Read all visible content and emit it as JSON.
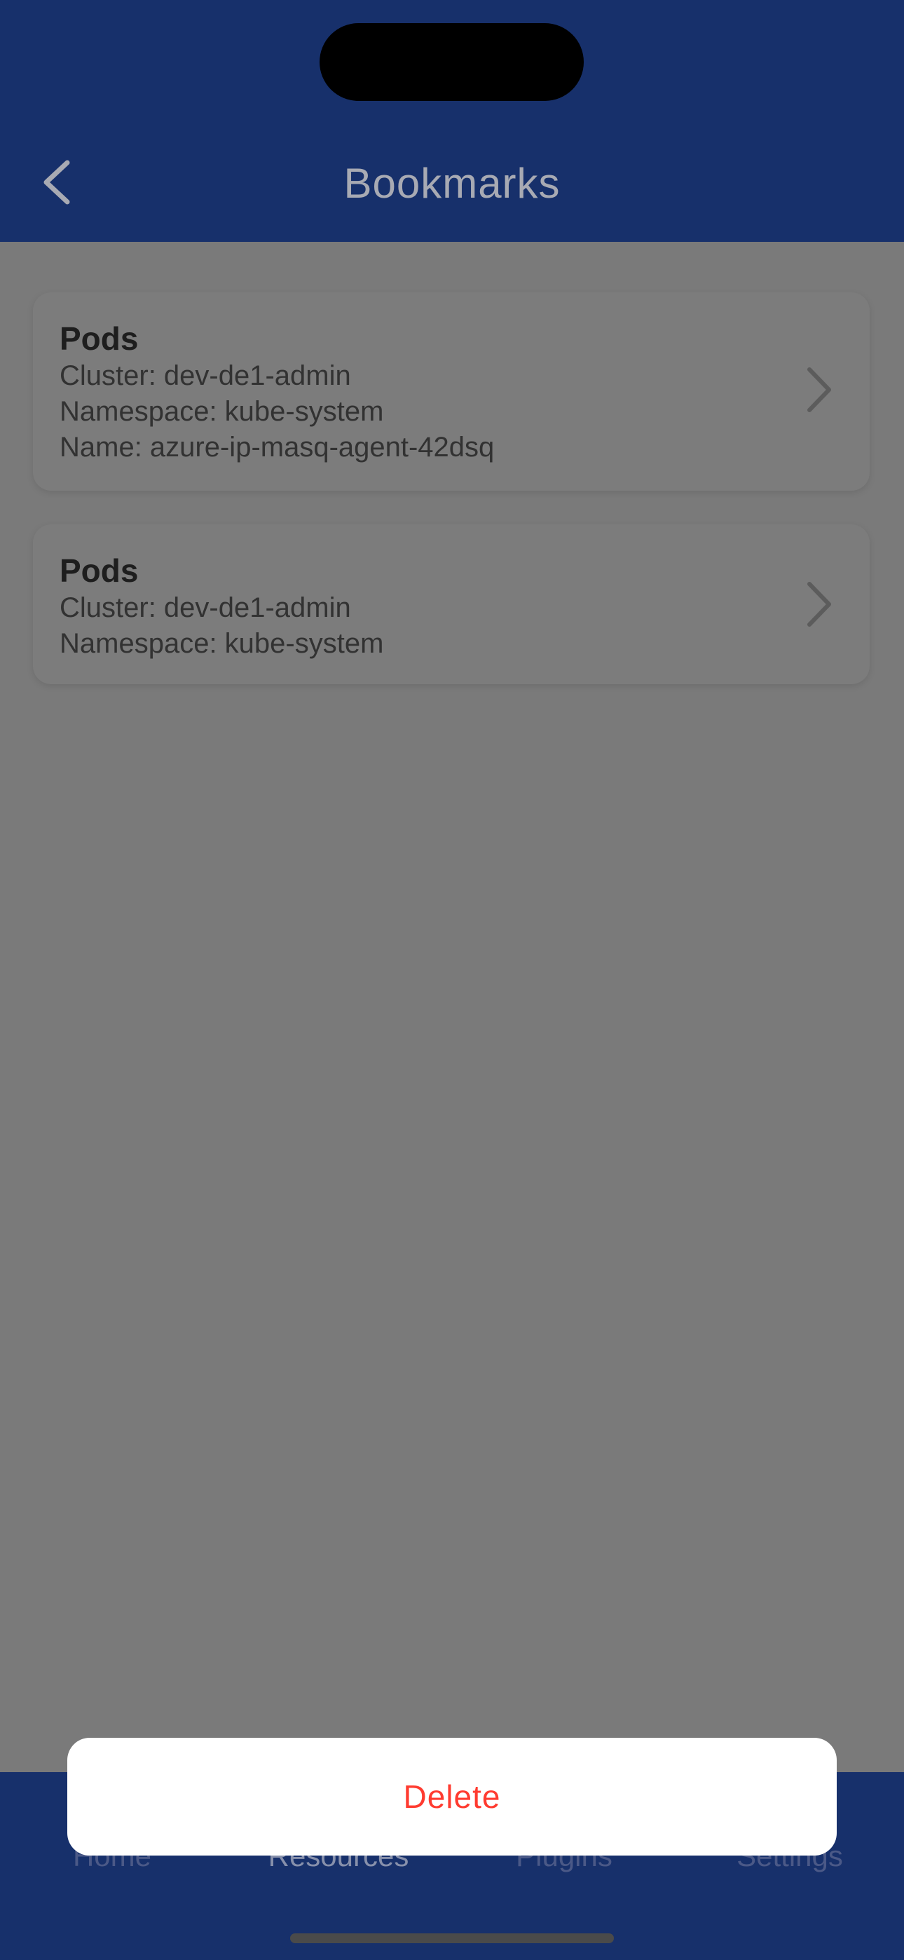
{
  "header": {
    "title": "Bookmarks",
    "back_icon": "chevron-left-icon"
  },
  "bookmarks": [
    {
      "title": "Pods",
      "lines": [
        "Cluster: dev-de1-admin",
        "Namespace: kube-system",
        "Name: azure-ip-masq-agent-42dsq"
      ]
    },
    {
      "title": "Pods",
      "lines": [
        "Cluster: dev-de1-admin",
        "Namespace: kube-system"
      ]
    }
  ],
  "tabbar": {
    "tabs": [
      {
        "label": "Home"
      },
      {
        "label": "Resources"
      },
      {
        "label": "Plugins"
      },
      {
        "label": "Settings"
      }
    ],
    "active_index": 1
  },
  "action_sheet": {
    "delete_label": "Delete"
  },
  "colors": {
    "header_bg": "#17306b",
    "overlay_bg": "#7a7a7a",
    "destructive": "#ff3b30"
  }
}
